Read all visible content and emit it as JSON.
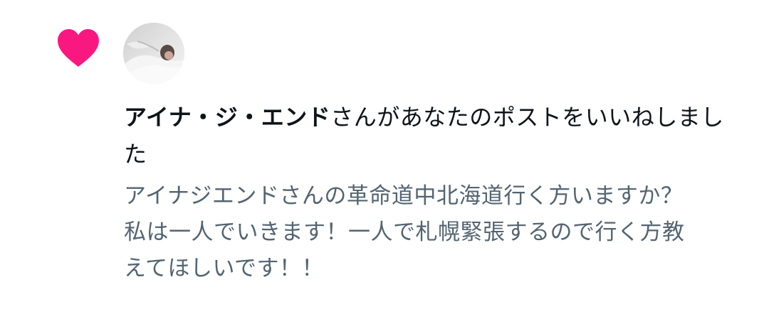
{
  "notification": {
    "type_icon": "heart-icon",
    "accent_color": "#f91880",
    "avatar": "user-avatar",
    "actor_name": "アイナ・ジ・エンド",
    "action_text": "さんがあなたのポストをいいねしました",
    "post_preview": "アイナジエンドさんの革命道中北海道行く方いますか？\n私は一人でいきます！一人で札幌緊張するので行く方教\nえてほしいです！！"
  }
}
